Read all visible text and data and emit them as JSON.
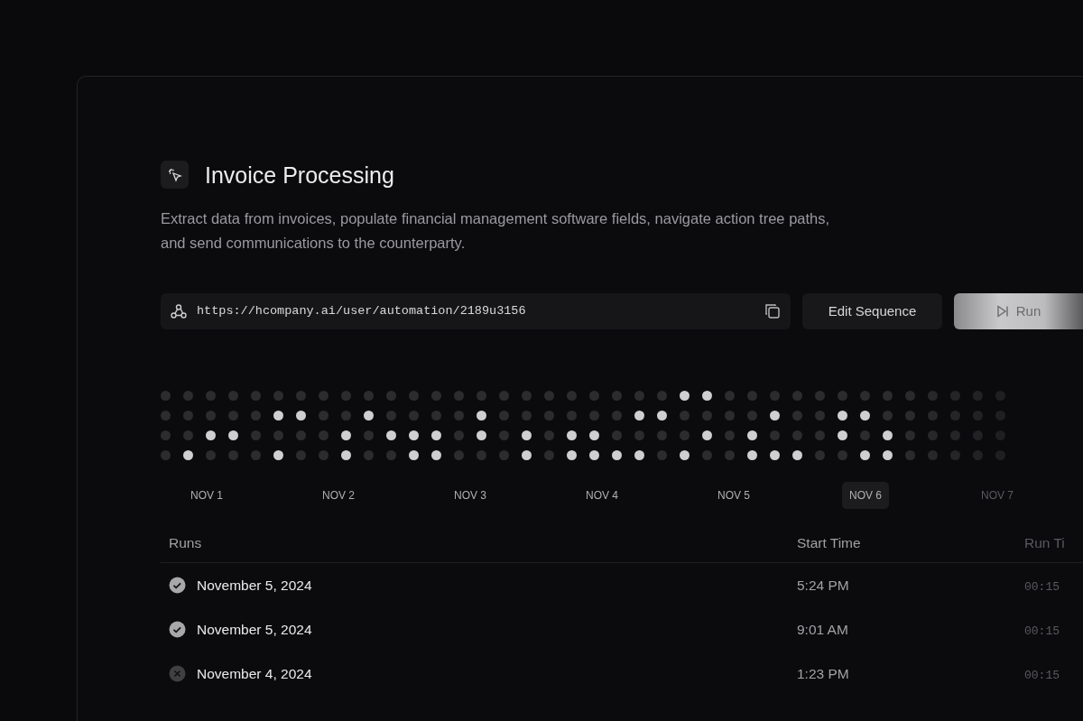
{
  "automation": {
    "title": "Invoice Processing",
    "description": "Extract data from invoices, populate financial management software fields, navigate action tree paths, and send communications to the counterparty.",
    "url": "https://hcompany.ai/user/automation/2189u3156"
  },
  "buttons": [
    {
      "label": "Edit Sequence",
      "kind": "secondary"
    },
    {
      "label": "Run",
      "kind": "primary"
    }
  ],
  "activity": {
    "rows": [
      {
        "dots": [
          {
            "on": false
          },
          {
            "on": false
          },
          {
            "on": false
          },
          {
            "on": false
          },
          {
            "on": false
          },
          {
            "on": false
          },
          {
            "on": false
          },
          {
            "on": false
          },
          {
            "on": false
          },
          {
            "on": false
          },
          {
            "on": false
          },
          {
            "on": false
          },
          {
            "on": false
          },
          {
            "on": false
          },
          {
            "on": false
          },
          {
            "on": false
          },
          {
            "on": false
          },
          {
            "on": false
          },
          {
            "on": false
          },
          {
            "on": false
          },
          {
            "on": false
          },
          {
            "on": false
          },
          {
            "on": false
          },
          {
            "on": true
          },
          {
            "on": true
          },
          {
            "on": false
          },
          {
            "on": false
          },
          {
            "on": false
          },
          {
            "on": false
          },
          {
            "on": false
          },
          {
            "on": false
          },
          {
            "on": false
          },
          {
            "on": false
          },
          {
            "on": false
          },
          {
            "on": false
          },
          {
            "on": false
          },
          {
            "on": false
          },
          {
            "on": false
          }
        ]
      },
      {
        "dots": [
          {
            "on": false
          },
          {
            "on": false
          },
          {
            "on": false
          },
          {
            "on": false
          },
          {
            "on": false
          },
          {
            "on": true
          },
          {
            "on": true
          },
          {
            "on": false
          },
          {
            "on": false
          },
          {
            "on": true
          },
          {
            "on": false
          },
          {
            "on": false
          },
          {
            "on": false
          },
          {
            "on": false
          },
          {
            "on": true
          },
          {
            "on": false
          },
          {
            "on": false
          },
          {
            "on": false
          },
          {
            "on": false
          },
          {
            "on": false
          },
          {
            "on": false
          },
          {
            "on": true
          },
          {
            "on": true
          },
          {
            "on": false
          },
          {
            "on": false
          },
          {
            "on": false
          },
          {
            "on": false
          },
          {
            "on": true
          },
          {
            "on": false
          },
          {
            "on": false
          },
          {
            "on": true
          },
          {
            "on": true
          },
          {
            "on": false
          },
          {
            "on": false
          },
          {
            "on": false
          },
          {
            "on": false
          },
          {
            "on": false
          },
          {
            "on": false
          }
        ]
      },
      {
        "dots": [
          {
            "on": false
          },
          {
            "on": false
          },
          {
            "on": true
          },
          {
            "on": true
          },
          {
            "on": false
          },
          {
            "on": false
          },
          {
            "on": false
          },
          {
            "on": false
          },
          {
            "on": true
          },
          {
            "on": false
          },
          {
            "on": true
          },
          {
            "on": true
          },
          {
            "on": true
          },
          {
            "on": false
          },
          {
            "on": true
          },
          {
            "on": false
          },
          {
            "on": true
          },
          {
            "on": false
          },
          {
            "on": true
          },
          {
            "on": true
          },
          {
            "on": false
          },
          {
            "on": false
          },
          {
            "on": false
          },
          {
            "on": false
          },
          {
            "on": true
          },
          {
            "on": false
          },
          {
            "on": true
          },
          {
            "on": false
          },
          {
            "on": false
          },
          {
            "on": false
          },
          {
            "on": true
          },
          {
            "on": false
          },
          {
            "on": true
          },
          {
            "on": false
          },
          {
            "on": false
          },
          {
            "on": false
          },
          {
            "on": false
          },
          {
            "on": false
          }
        ]
      },
      {
        "dots": [
          {
            "on": false
          },
          {
            "on": true
          },
          {
            "on": false
          },
          {
            "on": false
          },
          {
            "on": false
          },
          {
            "on": true
          },
          {
            "on": false
          },
          {
            "on": false
          },
          {
            "on": true
          },
          {
            "on": false
          },
          {
            "on": false
          },
          {
            "on": true
          },
          {
            "on": true
          },
          {
            "on": false
          },
          {
            "on": false
          },
          {
            "on": false
          },
          {
            "on": true
          },
          {
            "on": false
          },
          {
            "on": true
          },
          {
            "on": true
          },
          {
            "on": true
          },
          {
            "on": true
          },
          {
            "on": false
          },
          {
            "on": true
          },
          {
            "on": false
          },
          {
            "on": false
          },
          {
            "on": true
          },
          {
            "on": true
          },
          {
            "on": true
          },
          {
            "on": false
          },
          {
            "on": false
          },
          {
            "on": true
          },
          {
            "on": true
          },
          {
            "on": false
          },
          {
            "on": false
          },
          {
            "on": false
          },
          {
            "on": false
          },
          {
            "on": false
          }
        ]
      }
    ],
    "days": [
      {
        "label": "NOV 1",
        "selected": false
      },
      {
        "label": "NOV 2",
        "selected": false
      },
      {
        "label": "NOV 3",
        "selected": false
      },
      {
        "label": "NOV 4",
        "selected": false
      },
      {
        "label": "NOV 5",
        "selected": false
      },
      {
        "label": "NOV 6",
        "selected": true
      },
      {
        "label": "NOV 7",
        "selected": false
      }
    ]
  },
  "runs": {
    "columns": [
      "Runs",
      "Start Time",
      "Run Ti"
    ],
    "rows": [
      {
        "failed": false,
        "date": "November 5, 2024",
        "start": "5:24 PM",
        "duration": "00:15"
      },
      {
        "failed": false,
        "date": "November 5, 2024",
        "start": "9:01 AM",
        "duration": "00:15"
      },
      {
        "failed": true,
        "date": "November 4, 2024",
        "start": "1:23 PM",
        "duration": "00:15"
      }
    ]
  }
}
